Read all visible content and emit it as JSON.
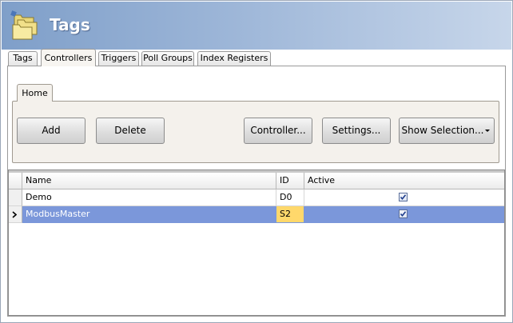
{
  "header": {
    "title": "Tags",
    "icon": "folders-icon"
  },
  "tabs": [
    {
      "label": "Tags",
      "active": false
    },
    {
      "label": "Controllers",
      "active": true
    },
    {
      "label": "Triggers",
      "active": false
    },
    {
      "label": "Poll Groups",
      "active": false
    },
    {
      "label": "Index Registers",
      "active": false
    }
  ],
  "ribbon": {
    "tab_label": "Home",
    "buttons": {
      "add": "Add",
      "delete": "Delete",
      "controller": "Controller...",
      "settings": "Settings...",
      "show_selection": "Show Selection..."
    }
  },
  "grid": {
    "columns": {
      "name": "Name",
      "id": "ID",
      "active": "Active"
    },
    "rows": [
      {
        "name": "Demo",
        "id": "D0",
        "active": true,
        "selected": false
      },
      {
        "name": "ModbusMaster",
        "id": "S2",
        "active": true,
        "selected": true
      }
    ]
  },
  "colors": {
    "selection": "#7b97da",
    "current_cell": "#ffd86b",
    "header_gradient_start": "#7f9fc9"
  }
}
